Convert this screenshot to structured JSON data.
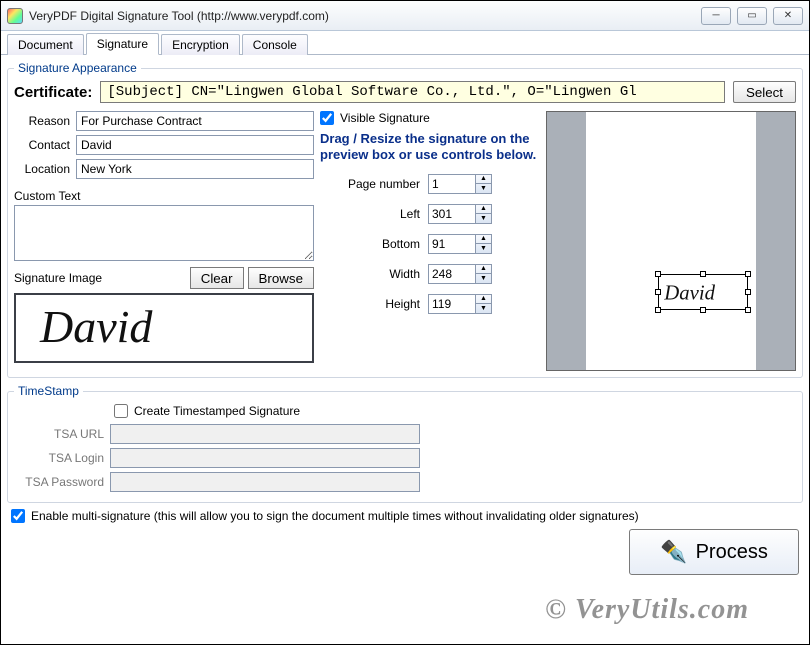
{
  "window": {
    "title": "VeryPDF Digital Signature Tool (http://www.verypdf.com)"
  },
  "tabs": {
    "document": "Document",
    "signature": "Signature",
    "encryption": "Encryption",
    "console": "Console"
  },
  "appearance": {
    "legend": "Signature Appearance",
    "certificate_label": "Certificate:",
    "certificate_value": "[Subject]  CN=\"Lingwen Global Software Co., Ltd.\", O=\"Lingwen Gl",
    "select_button": "Select",
    "reason_label": "Reason",
    "reason_value": "For Purchase Contract",
    "contact_label": "Contact",
    "contact_value": "David",
    "location_label": "Location",
    "location_value": "New York",
    "custom_text_label": "Custom Text",
    "custom_text_value": "",
    "sigimg_label": "Signature Image",
    "clear_button": "Clear",
    "browse_button": "Browse",
    "signature_image_text": "David",
    "visible_signature_label": "Visible Signature",
    "visible_signature_checked": true,
    "instruction": "Drag / Resize the signature on the preview box or use controls below.",
    "page_number_label": "Page number",
    "page_number_value": "1",
    "left_label": "Left",
    "left_value": "301",
    "bottom_label": "Bottom",
    "bottom_value": "91",
    "width_label": "Width",
    "width_value": "248",
    "height_label": "Height",
    "height_value": "119"
  },
  "timestamp": {
    "legend": "TimeStamp",
    "create_label": "Create Timestamped Signature",
    "create_checked": false,
    "tsa_url_label": "TSA URL",
    "tsa_url_value": "",
    "tsa_login_label": "TSA Login",
    "tsa_login_value": "",
    "tsa_password_label": "TSA Password",
    "tsa_password_value": ""
  },
  "multi_sig": {
    "checked": true,
    "label": "Enable multi-signature (this will allow you to sign the document multiple times without invalidating older signatures)"
  },
  "process_button": "Process",
  "watermark": "© VeryUtils.com"
}
